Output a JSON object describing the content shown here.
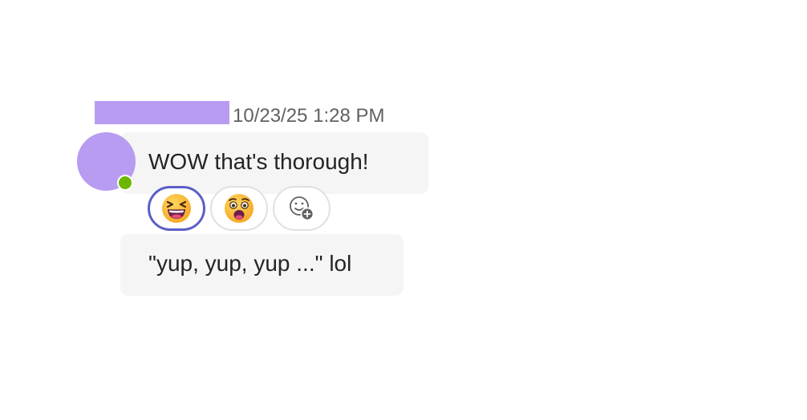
{
  "message": {
    "timestamp": "10/23/25 1:28 PM",
    "first_text": "WOW that's thorough!",
    "second_text": "\"yup, yup, yup ...\" lol"
  },
  "reactions": [
    {
      "icon": "laughing-face-icon",
      "selected": true
    },
    {
      "icon": "surprised-face-icon",
      "selected": false
    },
    {
      "icon": "add-reaction-icon",
      "selected": false
    }
  ],
  "colors": {
    "redaction": "#b79cf2",
    "avatar": "#b79cf2",
    "presence": "#6bb700",
    "selected_border": "#5b5fc7",
    "bubble": "#f5f5f5"
  }
}
